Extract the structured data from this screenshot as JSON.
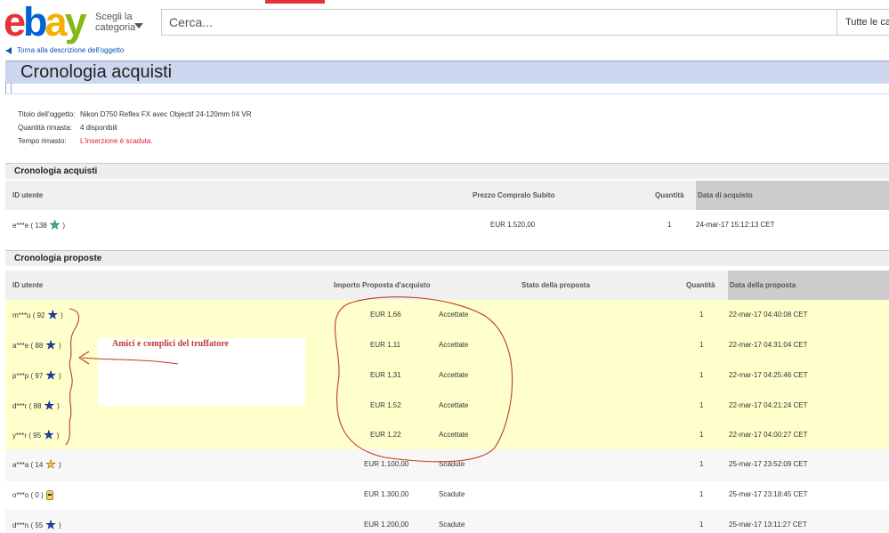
{
  "header": {
    "logo_letters": [
      "e",
      "b",
      "a",
      "y"
    ],
    "category_button": "Scegli la categoria",
    "search_placeholder": "Cerca...",
    "search_category": "Tutte le cat"
  },
  "back_link": "Torna alla descrizione dell'oggetto",
  "page_title": "Cronologia acquisti",
  "item_info": [
    {
      "label": "Titolo dell'oggetto:",
      "value": "Nikon D750 Reflex FX avec Objectif 24-120mm f/4 VR"
    },
    {
      "label": "Quantità rimasta:",
      "value": "4 disponibili"
    },
    {
      "label": "Tempo rimasto:",
      "value": "L'inserzione è scaduta."
    }
  ],
  "purchases": {
    "title": "Cronologia acquisti",
    "headers": [
      "ID utente",
      "Prezzo Compralo Subito",
      "Quantità",
      "Data di acquisto"
    ],
    "rows": [
      {
        "user": "e***e",
        "score": "( 138",
        "close": ")",
        "icon": "teal-star-icon",
        "price": "EUR 1.520,00",
        "qty": "1",
        "date": "24-mar-17 15:12:13 CET"
      }
    ]
  },
  "offers": {
    "title": "Cronologia proposte",
    "headers": [
      "ID utente",
      "Importo Proposta d'acquisto",
      "Stato della proposta",
      "Quantità",
      "Data della proposta"
    ],
    "rows": [
      {
        "user": "m***u",
        "score": "( 92",
        "close": ")",
        "icon": "blue-star-icon",
        "amount": "EUR 1,66",
        "status": "Accettate",
        "qty": "1",
        "date": "22-mar-17 04:40:08 CET"
      },
      {
        "user": "a***e",
        "score": "( 88",
        "close": ")",
        "icon": "blue-star-icon",
        "amount": "EUR 1,11",
        "status": "Accettate",
        "qty": "1",
        "date": "22-mar-17 04:31:04 CET"
      },
      {
        "user": "p***p",
        "score": "( 97",
        "close": ")",
        "icon": "blue-star-icon",
        "amount": "EUR 1,31",
        "status": "Accettate",
        "qty": "1",
        "date": "22-mar-17 04:25:46 CET"
      },
      {
        "user": "d***r",
        "score": "( 88",
        "close": ")",
        "icon": "blue-star-icon",
        "amount": "EUR 1,52",
        "status": "Accettate",
        "qty": "1",
        "date": "22-mar-17 04:21:24 CET"
      },
      {
        "user": "y***r",
        "score": "( 95",
        "close": ")",
        "icon": "blue-star-icon",
        "amount": "EUR 1,22",
        "status": "Accettate",
        "qty": "1",
        "date": "22-mar-17 04:00:27 CET"
      },
      {
        "user": "a***a",
        "score": "( 14",
        "close": ")",
        "icon": "yellow-star-icon",
        "amount": "EUR 1.100,00",
        "status": "Scadute",
        "qty": "1",
        "date": "25-mar-17 23:52:09 CET"
      },
      {
        "user": "o***o",
        "score": "( 0 )",
        "close": "",
        "icon": "new-user-shades-icon",
        "amount": "EUR 1.300,00",
        "status": "Scadute",
        "qty": "1",
        "date": "25-mar-17 23:18:45 CET"
      },
      {
        "user": "d***n",
        "score": "( 55",
        "close": ")",
        "icon": "blue-star-icon",
        "amount": "EUR 1.200,00",
        "status": "Scadute",
        "qty": "1",
        "date": "25-mar-17 13:11:27 CET"
      }
    ]
  },
  "annotation": "Amici e complici del truffatore",
  "colors": {
    "ebay_red": "#e53238",
    "ebay_blue": "#0064d2",
    "ebay_yellow": "#f5af02",
    "ebay_green": "#86b817",
    "title_band": "#ccd6ee",
    "highlight_rows": "#ffffcc",
    "link": "#0654ba",
    "expired_red": "#dd1e31",
    "ink": "#c0392b"
  }
}
